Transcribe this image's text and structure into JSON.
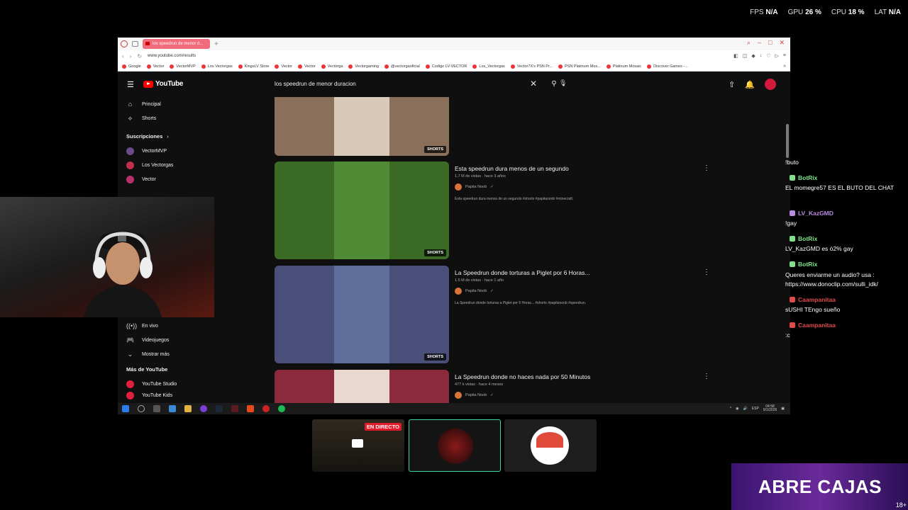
{
  "stats": {
    "fps_label": "FPS",
    "fps_value": "N/A",
    "gpu_label": "GPU",
    "gpu_value": "26 %",
    "cpu_label": "CPU",
    "cpu_value": "18 %",
    "lat_label": "LAT",
    "lat_value": "N/A"
  },
  "browser": {
    "tab_title": "los speedrun de menor d...",
    "url": "www.youtube.com/results",
    "bookmarks": [
      "Google",
      "Vector",
      "VectorMVP",
      "Los Vectorgas",
      "KingsLV Store",
      "Vector",
      "Vector",
      "Vectorga",
      "Vectorgaming",
      "@vectorgaoficial",
      "Codigo LV-VECTOR",
      "Los_Vectorgas",
      "Vector7X's PSN Pr...",
      "PSN Platinum Mos...",
      "Platinum Mosaic",
      "Discover Games -..."
    ]
  },
  "youtube": {
    "logo": "YouTube",
    "search_query": "los speedrun de menor duracion",
    "sidebar": {
      "items": [
        {
          "icon": "home-icon",
          "label": "Principal"
        },
        {
          "icon": "shorts-icon",
          "label": "Shorts"
        }
      ],
      "subscriptions_title": "Suscripciones",
      "subs": [
        {
          "label": "VectorMVP",
          "color": "#6b4b8a"
        },
        {
          "label": "Los Vectorgas",
          "color": "#c0304a"
        },
        {
          "label": "Vector",
          "color": "#b8306a"
        }
      ],
      "explore": [
        {
          "icon": "live-icon",
          "label": "En vivo"
        },
        {
          "icon": "gaming-icon",
          "label": "Videojuegos"
        },
        {
          "icon": "chevron-down-icon",
          "label": "Mostrar más"
        }
      ],
      "more_title": "Más de YouTube",
      "more": [
        {
          "label": "YouTube Studio"
        },
        {
          "label": "YouTube Kids"
        }
      ]
    },
    "results": [
      {
        "title": "",
        "meta": "",
        "channel": "",
        "desc": "",
        "badge": "SHORTS",
        "bg": "#8a6f5a",
        "inner": "#d8c9b8"
      },
      {
        "title": "Esta speedrun dura menos de un segundo",
        "meta": "1.7 M de vistas · hace 3 años",
        "channel": "Papita Noob",
        "desc": "Esta speedrun dura menos de un segundo #shorts #papitanoob #minecraft.",
        "badge": "SHORTS",
        "bg": "#3b6b25",
        "inner": "#4f8a34"
      },
      {
        "title": "La Speedrun donde torturas a Piglet por 6 Horas...",
        "meta": "1.5 M de vistas · hace 1 año",
        "channel": "Papita Noob",
        "desc": "La Speedrun donde torturas a Piglet por 6 Horas... #shorts #papitanoob #speedrun.",
        "badge": "SHORTS",
        "bg": "#4a4f7a",
        "inner": "#5f6e9a"
      },
      {
        "title": "La Speedrun donde no haces nada por 50 Minutos",
        "meta": "477 k vistas · hace 4 meses",
        "channel": "Papita Noob",
        "desc": "La Speedrun donde no haces nada por 50 Minutos #shorts #papitanoob #speedrun.",
        "badge": "",
        "bg": "#8a2a3a",
        "inner": "#e8d8d0"
      }
    ]
  },
  "taskbar": {
    "time": "04:58",
    "date": "9/1/2026",
    "lang": "ESP"
  },
  "chat": [
    {
      "type": "text",
      "text": "!buto"
    },
    {
      "type": "user",
      "name": "BotRix",
      "color": "#7fe08a"
    },
    {
      "type": "text",
      "text": "EL momegre57 ES EL BUTO DEL CHAT"
    },
    {
      "type": "user",
      "name": "LV_KazGMD",
      "color": "#b88ae0"
    },
    {
      "type": "text",
      "text": "!gay"
    },
    {
      "type": "user",
      "name": "BotRix",
      "color": "#7fe08a"
    },
    {
      "type": "text",
      "text": "LV_KazGMD es ó2% gay"
    },
    {
      "type": "user",
      "name": "BotRix",
      "color": "#7fe08a"
    },
    {
      "type": "text",
      "text": "Queres enviarme un audio? usa :"
    },
    {
      "type": "text",
      "text": "https://www.donoclip.com/sulli_idk/"
    },
    {
      "type": "user",
      "name": "Caampanitaa",
      "color": "#e04a4a"
    },
    {
      "type": "text",
      "text": "sUSHI TEngo sueño"
    },
    {
      "type": "user",
      "name": "Caampanitaa",
      "color": "#e04a4a"
    },
    {
      "type": "text",
      "text": ":c"
    }
  ],
  "cards": {
    "live_label": "EN DIRECTO"
  },
  "promo": {
    "text": "ABRE CAJAS",
    "age": "18+"
  }
}
